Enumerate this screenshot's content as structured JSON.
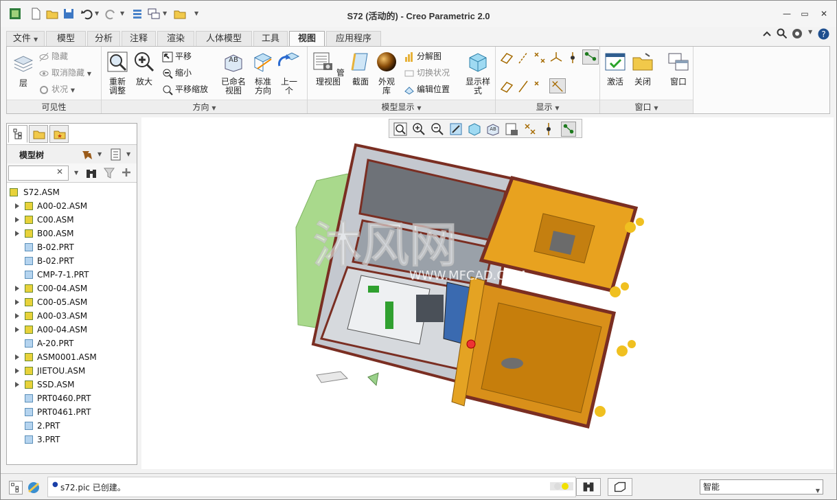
{
  "window": {
    "title": "S72 (活动的) - Creo Parametric 2.0",
    "controls": {
      "minimize": "—",
      "restore": "▭",
      "close": "✕"
    }
  },
  "tabs": [
    "文件",
    "模型",
    "分析",
    "注释",
    "渲染",
    "人体模型",
    "工具",
    "视图",
    "应用程序"
  ],
  "ribbon": {
    "visibility": {
      "label": "可见性",
      "layer": "层",
      "hide": "隐藏",
      "unhide": "取消隐藏",
      "status": "状况"
    },
    "orientation": {
      "label": "方向",
      "refit": "重新调整",
      "zoom_in": "放大",
      "pan": "平移",
      "zoom_out": "缩小",
      "pan_zoom": "平移缩放",
      "named_views": "已命名视图",
      "standard": "标准方向",
      "previous": "上一个"
    },
    "model_display": {
      "label": "模型显示",
      "manage_views": "管理视图",
      "section": "截面",
      "appearance": "外观库",
      "exploded": "分解图",
      "toggle_status": "切换状况",
      "edit_position": "编辑位置",
      "display_style": "显示样式"
    },
    "show": {
      "label": "显示"
    },
    "window": {
      "label": "窗口",
      "activate": "激活",
      "close": "关闭",
      "windows": "窗口"
    }
  },
  "model_tree": {
    "header": "模型树",
    "search_placeholder": "",
    "root": "S72.ASM",
    "items": [
      {
        "label": "A00-02.ASM",
        "expandable": true,
        "type": "asm"
      },
      {
        "label": "C00.ASM",
        "expandable": true,
        "type": "asm"
      },
      {
        "label": "B00.ASM",
        "expandable": true,
        "type": "asm"
      },
      {
        "label": "B-02.PRT",
        "expandable": false,
        "type": "prt"
      },
      {
        "label": "B-02.PRT",
        "expandable": false,
        "type": "prt"
      },
      {
        "label": "CMP-7-1.PRT",
        "expandable": false,
        "type": "prt"
      },
      {
        "label": "C00-04.ASM",
        "expandable": true,
        "type": "asm"
      },
      {
        "label": "C00-05.ASM",
        "expandable": true,
        "type": "asm"
      },
      {
        "label": "A00-03.ASM",
        "expandable": true,
        "type": "asm"
      },
      {
        "label": "A00-04.ASM",
        "expandable": true,
        "type": "asm"
      },
      {
        "label": "A-20.PRT",
        "expandable": false,
        "type": "prt"
      },
      {
        "label": "ASM0001.ASM",
        "expandable": true,
        "type": "asm"
      },
      {
        "label": "JIETOU.ASM",
        "expandable": true,
        "type": "asm"
      },
      {
        "label": "SSD.ASM",
        "expandable": true,
        "type": "asm"
      },
      {
        "label": "PRT0460.PRT",
        "expandable": false,
        "type": "prt"
      },
      {
        "label": "PRT0461.PRT",
        "expandable": false,
        "type": "prt"
      },
      {
        "label": "2.PRT",
        "expandable": false,
        "type": "prt"
      },
      {
        "label": "3.PRT",
        "expandable": false,
        "type": "prt"
      }
    ]
  },
  "watermark": {
    "main": "沐风网",
    "url": "WWW.MFCAD.COM"
  },
  "status": {
    "message": "s72.pic 已创建。",
    "filter": "智能"
  },
  "colors": {
    "accent": "#2d6db5",
    "model_frame": "#8b3a2a",
    "model_orange": "#e8a21f",
    "model_green": "#a8d68a"
  }
}
